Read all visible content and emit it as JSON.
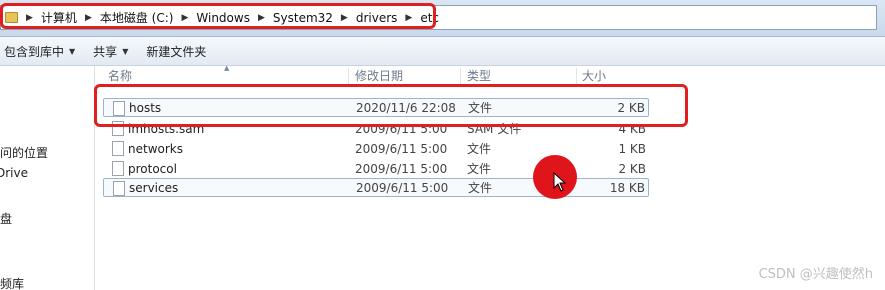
{
  "address": {
    "crumbs": [
      "计算机",
      "本地磁盘 (C:)",
      "Windows",
      "System32",
      "drivers",
      "etc"
    ]
  },
  "toolbar": {
    "include_library": "包含到库中",
    "share": "共享",
    "new_folder": "新建文件夹"
  },
  "nav": {
    "items": [
      "访问的位置",
      "Drive",
      "磁盘",
      "视频库"
    ]
  },
  "columns": {
    "name": "名称",
    "date": "修改日期",
    "type": "类型",
    "size": "大小"
  },
  "files": [
    {
      "name": "hosts",
      "date": "2020/11/6 22:08",
      "type": "文件",
      "size": "2 KB"
    },
    {
      "name": "lmhosts.sam",
      "date": "2009/6/11 5:00",
      "type": "SAM 文件",
      "size": "4 KB"
    },
    {
      "name": "networks",
      "date": "2009/6/11 5:00",
      "type": "文件",
      "size": "1 KB"
    },
    {
      "name": "protocol",
      "date": "2009/6/11 5:00",
      "type": "文件",
      "size": "2 KB"
    },
    {
      "name": "services",
      "date": "2009/6/11 5:00",
      "type": "文件",
      "size": "18 KB"
    }
  ],
  "watermark": "CSDN @兴趣使然h",
  "colors": {
    "highlight": "#e02020",
    "click_marker": "#e0141b"
  }
}
